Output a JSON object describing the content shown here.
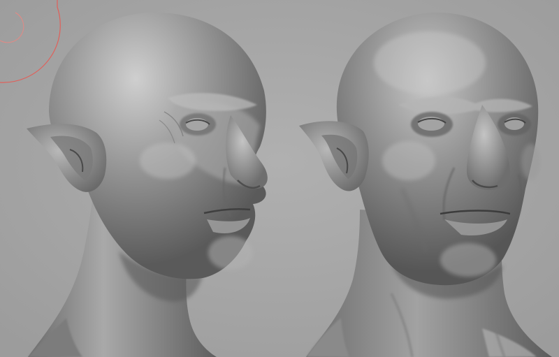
{
  "viewport": {
    "background_color": "#a7a7a7",
    "material_color": "#8f8f8f",
    "material_highlight": "#c9c9c9",
    "material_shadow": "#4a4a4a",
    "brush_cursor_color": "#e0605a"
  },
  "models": [
    {
      "view": "three-quarter-right"
    },
    {
      "view": "three-quarter-front"
    }
  ]
}
